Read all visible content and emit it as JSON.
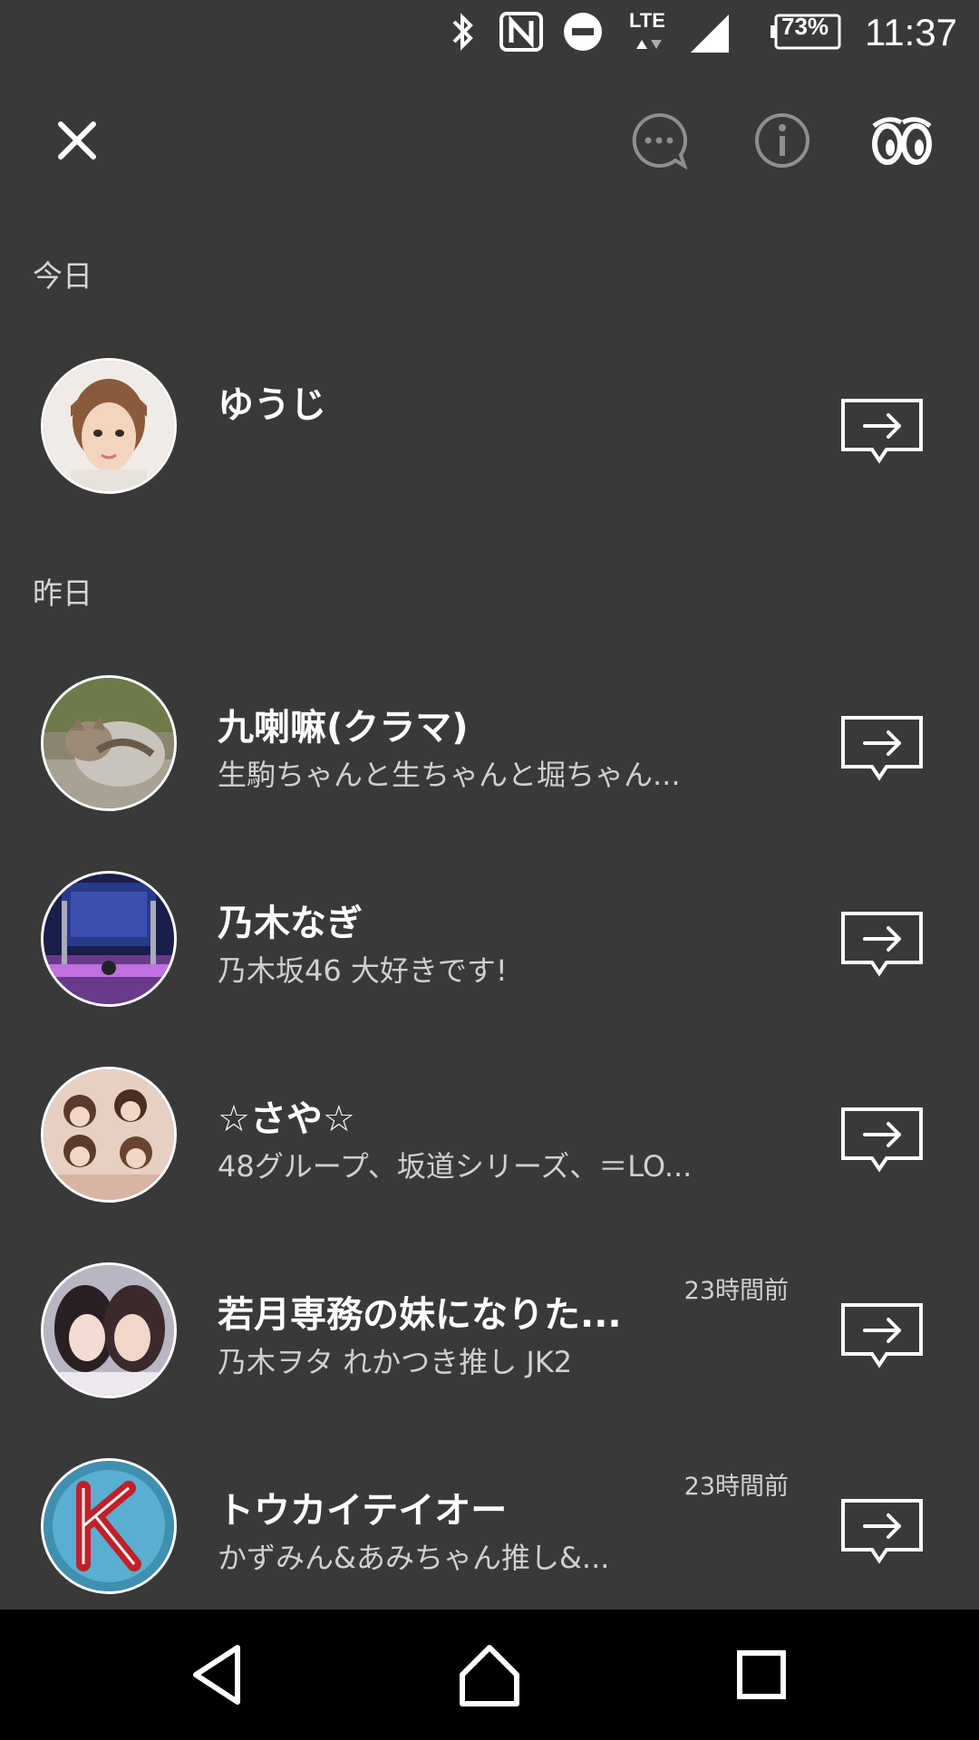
{
  "status_bar": {
    "battery": "73%",
    "network": "LTE",
    "time": "11:37",
    "icons": [
      "bluetooth-icon",
      "nfc-icon",
      "do-not-disturb-icon",
      "lte-icon",
      "signal-icon",
      "battery-icon"
    ]
  },
  "toolbar": {
    "icons": [
      "close-icon",
      "chat-bubble-icon",
      "info-icon",
      "eyes-icon"
    ]
  },
  "sections": [
    {
      "label": "今日"
    },
    {
      "label": "昨日"
    }
  ],
  "rows": [
    {
      "name": "ゆうじ",
      "status": "",
      "time": "",
      "avatar": "portrait-photo"
    },
    {
      "name": "九喇嘛(クラマ)",
      "status": "生駒ちゃんと生ちゃんと堀ちゃん...",
      "time": "",
      "avatar": "cat-photo"
    },
    {
      "name": "乃木なぎ",
      "status": "乃木坂46  大好きです!",
      "time": "",
      "avatar": "concert-photo"
    },
    {
      "name": "☆さや☆",
      "status": "48グループ、坂道シリーズ、＝LO...",
      "time": "",
      "avatar": "group-photo"
    },
    {
      "name": "若月専務の妹になりた...",
      "status": "乃木ヲタ  れかつき推し  JK2",
      "time": "23時間前",
      "avatar": "two-girls-photo"
    },
    {
      "name": "トウカイテイオー",
      "status": "かずみん&あみちゃん推し&...",
      "time": "23時間前",
      "avatar": "k-logo"
    }
  ],
  "nav": {
    "icons": [
      "back-icon",
      "home-icon",
      "recents-icon"
    ]
  },
  "colors": {
    "background": "#383a39",
    "nav_background": "#000000",
    "text": "#ffffff",
    "secondary_text": "#cfd1d0"
  }
}
